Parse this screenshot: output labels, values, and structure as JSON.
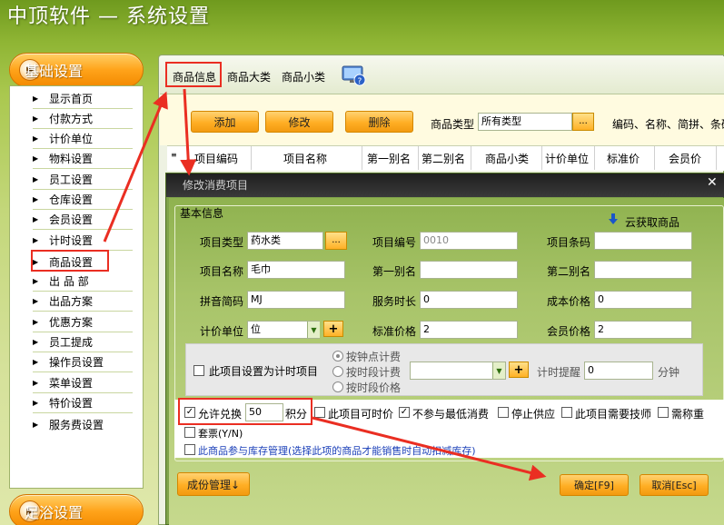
{
  "app": {
    "title": "中顶软件 — 系统设置"
  },
  "sidebar": {
    "basic_title": "基础设置",
    "footer_title": "足浴设置",
    "items": [
      {
        "label": "显示首页"
      },
      {
        "label": "付款方式"
      },
      {
        "label": "计价单位"
      },
      {
        "label": "物料设置"
      },
      {
        "label": "员工设置"
      },
      {
        "label": "仓库设置"
      },
      {
        "label": "会员设置"
      },
      {
        "label": "计时设置"
      },
      {
        "label": "商品设置"
      },
      {
        "label": "出 品 部"
      },
      {
        "label": "出品方案"
      },
      {
        "label": "优惠方案"
      },
      {
        "label": "员工提成"
      },
      {
        "label": "操作员设置"
      },
      {
        "label": "菜单设置"
      },
      {
        "label": "特价设置"
      },
      {
        "label": "服务费设置"
      }
    ],
    "selected_index": 8
  },
  "tabs": [
    {
      "label": "商品信息"
    },
    {
      "label": "商品大类"
    },
    {
      "label": "商品小类"
    }
  ],
  "toolbar": {
    "add_label": "添加",
    "edit_label": "修改",
    "delete_label": "删除",
    "category_label": "商品类型",
    "category_value": "所有类型",
    "ellipsis": "...",
    "search_hint": "编码、名称、简拼、条码"
  },
  "grid": {
    "columns": [
      "项目编码",
      "项目名称",
      "第一别名",
      "第二别名",
      "商品小类",
      "计价单位",
      "标准价",
      "会员价"
    ]
  },
  "dialog": {
    "title": "修改消费项目",
    "close": "✕",
    "group_title": "基本信息",
    "cloud_fetch": "云获取商品",
    "fields": {
      "type_label": "项目类型",
      "type_value": "药水类",
      "code_label": "项目编号",
      "code_value": "0010",
      "barcode_label": "项目条码",
      "barcode_value": "",
      "name_label": "项目名称",
      "name_value": "毛巾",
      "alias1_label": "第一别名",
      "alias1_value": "",
      "alias2_label": "第二别名",
      "alias2_value": "",
      "pinyin_label": "拼音简码",
      "pinyin_value": "MJ",
      "duration_label": "服务时长",
      "duration_value": "0",
      "cost_label": "成本价格",
      "cost_value": "0",
      "unit_label": "计价单位",
      "unit_value": "位",
      "std_price_label": "标准价格",
      "std_price_value": "2",
      "member_price_label": "会员价格",
      "member_price_value": "2"
    },
    "timer": {
      "set_as_timer": "此项目设置为计时项目",
      "by_clock": "按钟点计费",
      "by_period": "按时段计费",
      "by_period_price": "按时段价格",
      "remind_label": "计时提醒",
      "remind_value": "0",
      "remind_unit": "分钟"
    },
    "options": {
      "allow_exchange": "允许兑换",
      "exchange_points": "50",
      "points_unit": "积分",
      "timeable": "此项目可时价",
      "no_min_spend": "不参与最低消费",
      "stop_supply": "停止供应",
      "need_tech": "此项目需要技师",
      "need_weigh": "需称重",
      "package": "套票(Y/N)",
      "inventory": "此商品参与库存管理(选择此项的商品才能销售时自动扣减库存)"
    },
    "cost_mgmt": "成份管理↓",
    "confirm": "确定[F9]",
    "cancel": "取消[Esc]"
  },
  "colors": {
    "accent_orange": "#ffa31a",
    "highlight_red": "#ea2e22",
    "dialog_green": "#8fb24f"
  }
}
